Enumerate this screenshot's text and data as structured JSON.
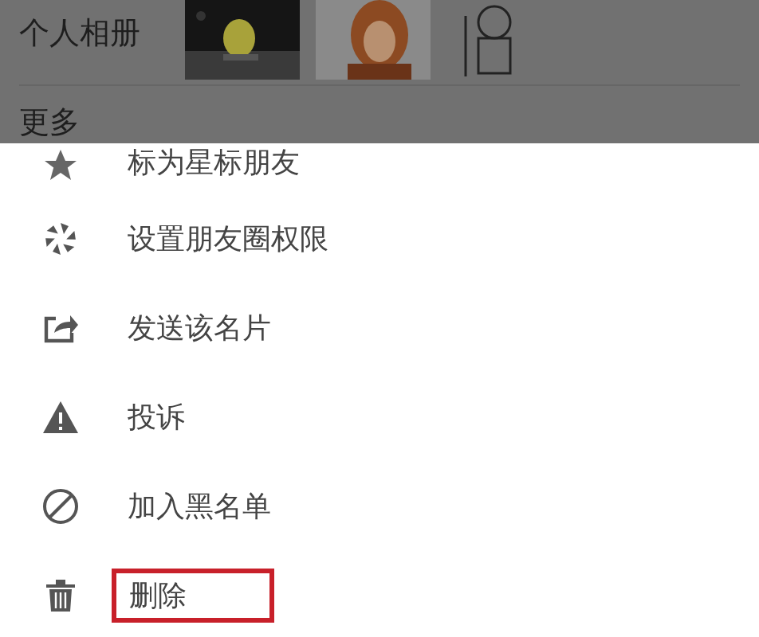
{
  "profile": {
    "album_label": "个人相册",
    "more_label": "更多"
  },
  "menu": {
    "items": [
      {
        "kind": "star",
        "label": "标为星标朋友",
        "highlighted": false
      },
      {
        "kind": "aperture",
        "label": "设置朋友圈权限",
        "highlighted": false
      },
      {
        "kind": "share",
        "label": "发送该名片",
        "highlighted": false
      },
      {
        "kind": "warning",
        "label": "投诉",
        "highlighted": false
      },
      {
        "kind": "block",
        "label": "加入黑名单",
        "highlighted": false
      },
      {
        "kind": "trash",
        "label": "删除",
        "highlighted": true
      }
    ]
  }
}
